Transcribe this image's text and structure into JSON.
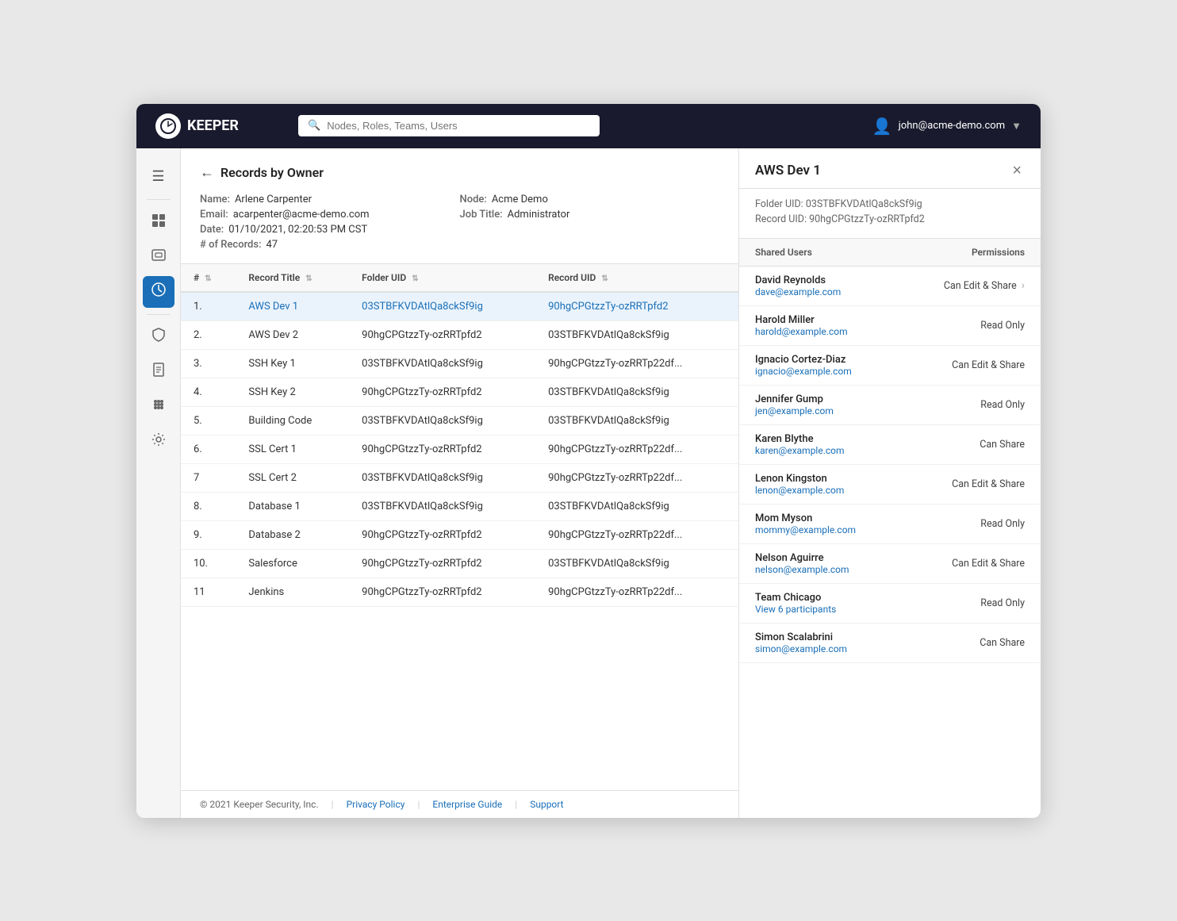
{
  "header": {
    "logo_text": "KEEPER",
    "search_placeholder": "Nodes, Roles, Teams, Users",
    "user_email": "john@acme-demo.com"
  },
  "sidebar": {
    "items": [
      {
        "id": "menu",
        "icon": "☰",
        "label": "Menu"
      },
      {
        "id": "dashboard",
        "icon": "⊞",
        "label": "Dashboard"
      },
      {
        "id": "vault",
        "icon": "⬜",
        "label": "Vault"
      },
      {
        "id": "reports",
        "icon": "🔵",
        "label": "Reports",
        "active": true
      },
      {
        "id": "records",
        "icon": "🔵",
        "label": "Records"
      },
      {
        "id": "docs",
        "icon": "📄",
        "label": "Documents"
      },
      {
        "id": "apps",
        "icon": "⊞",
        "label": "Apps"
      },
      {
        "id": "settings",
        "icon": "⚙",
        "label": "Settings"
      }
    ]
  },
  "records_panel": {
    "breadcrumb_back": "←",
    "title": "Records by Owner",
    "owner": {
      "name_label": "Name:",
      "name_value": "Arlene Carpenter",
      "email_label": "Email:",
      "email_value": "acarpenter@acme-demo.com",
      "node_label": "Node:",
      "node_value": "Acme Demo",
      "job_label": "Job Title:",
      "job_value": "Administrator",
      "date_label": "Date:",
      "date_value": "01/10/2021, 02:20:53 PM CST",
      "records_label": "# of Records:",
      "records_value": "47"
    },
    "table": {
      "columns": [
        {
          "key": "num",
          "label": "#",
          "sortable": true
        },
        {
          "key": "title",
          "label": "Record Title",
          "sortable": true
        },
        {
          "key": "folder_uid",
          "label": "Folder UID",
          "sortable": true
        },
        {
          "key": "record_uid",
          "label": "Record UID",
          "sortable": true
        }
      ],
      "rows": [
        {
          "num": "1.",
          "title": "AWS Dev 1",
          "folder_uid": "03STBFKVDAtlQa8ckSf9ig",
          "record_uid": "90hgCPGtzzTy-ozRRTpfd2",
          "selected": true,
          "link": true
        },
        {
          "num": "2.",
          "title": "AWS Dev 2",
          "folder_uid": "90hgCPGtzzTy-ozRRTpfd2",
          "record_uid": "03STBFKVDAtlQa8ckSf9ig",
          "selected": false
        },
        {
          "num": "3.",
          "title": "SSH Key 1",
          "folder_uid": "03STBFKVDAtlQa8ckSf9ig",
          "record_uid": "90hgCPGtzzTy-ozRRTp22df...",
          "selected": false
        },
        {
          "num": "4.",
          "title": "SSH Key 2",
          "folder_uid": "90hgCPGtzzTy-ozRRTpfd2",
          "record_uid": "03STBFKVDAtlQa8ckSf9ig",
          "selected": false
        },
        {
          "num": "5.",
          "title": "Building Code",
          "folder_uid": "03STBFKVDAtlQa8ckSf9ig",
          "record_uid": "03STBFKVDAtlQa8ckSf9ig",
          "selected": false
        },
        {
          "num": "6.",
          "title": "SSL Cert 1",
          "folder_uid": "90hgCPGtzzTy-ozRRTpfd2",
          "record_uid": "90hgCPGtzzTy-ozRRTp22df...",
          "selected": false
        },
        {
          "num": "7",
          "title": "SSL Cert 2",
          "folder_uid": "03STBFKVDAtlQa8ckSf9ig",
          "record_uid": "90hgCPGtzzTy-ozRRTp22df...",
          "selected": false
        },
        {
          "num": "8.",
          "title": "Database 1",
          "folder_uid": "03STBFKVDAtlQa8ckSf9ig",
          "record_uid": "03STBFKVDAtlQa8ckSf9ig",
          "selected": false
        },
        {
          "num": "9.",
          "title": "Database 2",
          "folder_uid": "90hgCPGtzzTy-ozRRTpfd2",
          "record_uid": "90hgCPGtzzTy-ozRRTp22df...",
          "selected": false
        },
        {
          "num": "10.",
          "title": "Salesforce",
          "folder_uid": "90hgCPGtzzTy-ozRRTpfd2",
          "record_uid": "03STBFKVDAtlQa8ckSf9ig",
          "selected": false
        },
        {
          "num": "11",
          "title": "Jenkins",
          "folder_uid": "90hgCPGtzzTy-ozRRTpfd2",
          "record_uid": "90hgCPGtzzTy-ozRRTp22df...",
          "selected": false
        }
      ]
    },
    "footer": {
      "copyright": "© 2021 Keeper Security, Inc.",
      "links": [
        "Privacy Policy",
        "Enterprise Guide",
        "Support"
      ]
    }
  },
  "detail_panel": {
    "title": "AWS Dev 1",
    "close_btn": "×",
    "folder_uid_label": "Folder UID:",
    "folder_uid_value": "03STBFKVDAtlQa8ckSf9ig",
    "record_uid_label": "Record UID:",
    "record_uid_value": "90hgCPGtzzTy-ozRRTpfd2",
    "shared_users_col": "Shared Users",
    "permissions_col": "Permissions",
    "shared_users": [
      {
        "name": "David Reynolds",
        "email": "dave@example.com",
        "permission": "Can Edit & Share",
        "has_arrow": true
      },
      {
        "name": "Harold Miller",
        "email": "harold@example.com",
        "permission": "Read Only",
        "has_arrow": false
      },
      {
        "name": "Ignacio Cortez-Diaz",
        "email": "ignacio@example.com",
        "permission": "Can Edit & Share",
        "has_arrow": false
      },
      {
        "name": "Jennifer Gump",
        "email": "jen@example.com",
        "permission": "Read Only",
        "has_arrow": false
      },
      {
        "name": "Karen Blythe",
        "email": "karen@example.com",
        "permission": "Can Share",
        "has_arrow": false
      },
      {
        "name": "Lenon Kingston",
        "email": "lenon@example.com",
        "permission": "Can Edit & Share",
        "has_arrow": false
      },
      {
        "name": "Mom Myson",
        "email": "mommy@example.com",
        "permission": "Read Only",
        "has_arrow": false
      },
      {
        "name": "Nelson Aguirre",
        "email": "nelson@example.com",
        "permission": "Can Edit & Share",
        "has_arrow": false
      },
      {
        "name": "Team Chicago",
        "email": "View 6 participants",
        "permission": "Read Only",
        "has_arrow": false,
        "is_team": true
      },
      {
        "name": "Simon Scalabrini",
        "email": "simon@example.com",
        "permission": "Can Share",
        "has_arrow": false
      }
    ]
  }
}
